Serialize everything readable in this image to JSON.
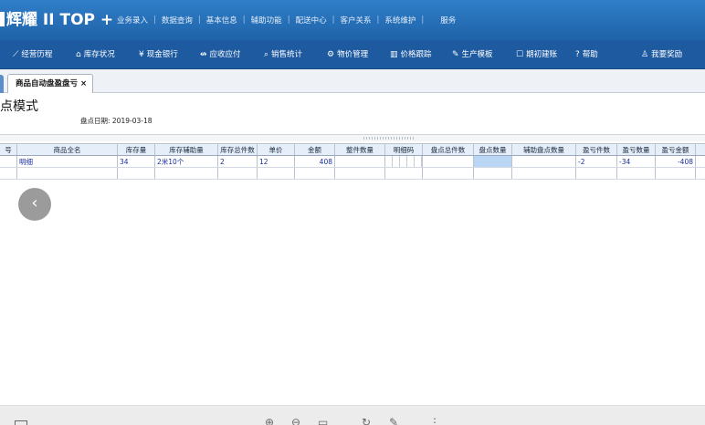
{
  "app": {
    "logo": "辉耀 II TOP +"
  },
  "top_menu": [
    "业务录入",
    "数据查询",
    "基本信息",
    "辅助功能",
    "配送中心",
    "客户关系",
    "系统维护",
    "服务"
  ],
  "toolbar": {
    "items": [
      {
        "label": "经营历程",
        "icon": "chart-line-icon"
      },
      {
        "label": "库存状况",
        "icon": "home-icon"
      },
      {
        "label": "现金银行",
        "icon": "yen-icon"
      },
      {
        "label": "应收应付",
        "icon": "transfer-icon"
      },
      {
        "label": "销售统计",
        "icon": "search-icon"
      },
      {
        "label": "物价管理",
        "icon": "gear-icon"
      },
      {
        "label": "价格跟踪",
        "icon": "chart-bar-icon"
      },
      {
        "label": "生产模板",
        "icon": "wrench-icon"
      },
      {
        "label": "期初建账",
        "icon": "edit-icon"
      },
      {
        "label": "帮助",
        "icon": "help-icon"
      },
      {
        "label": "我要奖励",
        "icon": "users-icon"
      }
    ]
  },
  "tab": {
    "label": "商品自动盘盈盘亏",
    "close": "×"
  },
  "page": {
    "title": "点模式",
    "date_label": "盘点日期: 2019-03-18"
  },
  "table": {
    "columns": [
      "号",
      "商品全名",
      "库存量",
      "库存辅助量",
      "库存总件数",
      "单价",
      "金额",
      "整件数量",
      "明细码",
      "盘点总件数",
      "盘点数量",
      "辅助盘点数量",
      "盈亏件数",
      "盈亏数量",
      "盈亏金额"
    ],
    "rows": [
      [
        "",
        "明细",
        "34",
        "2米10个",
        "2",
        "12",
        "408",
        "",
        "",
        "",
        "",
        "",
        "-2",
        "-34",
        "-408"
      ]
    ]
  },
  "bottom_bar": {
    "icons": [
      "window-icon",
      "zoom-in-icon",
      "zoom-out-icon",
      "fit-icon",
      "rotate-icon",
      "pen-icon",
      "more-icon"
    ]
  }
}
